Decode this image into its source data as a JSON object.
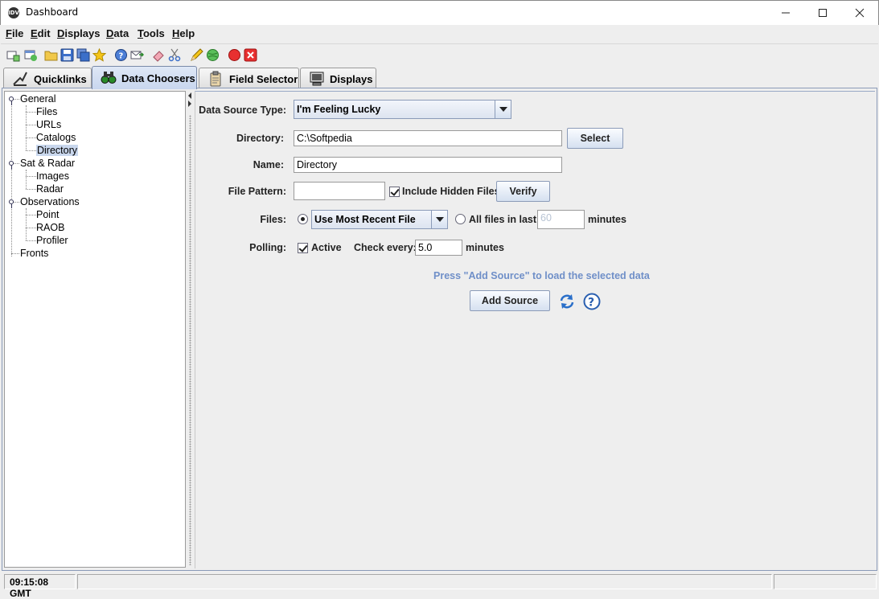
{
  "window": {
    "title": "Dashboard",
    "app_icon": "idv-logo-icon"
  },
  "menu": [
    {
      "label": "File",
      "mnemonic": "F",
      "rest": "ile"
    },
    {
      "label": "Edit",
      "mnemonic": "E",
      "rest": "dit"
    },
    {
      "label": "Displays",
      "mnemonic": "D",
      "rest": "isplays"
    },
    {
      "label": "Data",
      "mnemonic": "D",
      "rest": "ata"
    },
    {
      "label": "Tools",
      "mnemonic": "T",
      "rest": "ools"
    },
    {
      "label": "Help",
      "mnemonic": "H",
      "rest": "elp"
    }
  ],
  "toolbar_icons": [
    "new-window-icon",
    "open-folder-icon",
    "save-icon",
    "save-as-icon",
    "favorite-star-icon",
    "help-icon",
    "export-icon",
    "eraser-icon",
    "cut-icon",
    "pencil-icon",
    "globe-icon",
    "stop-icon",
    "close-icon"
  ],
  "tabs": [
    {
      "label": "Quicklinks",
      "icon": "quicklinks-icon",
      "active": false
    },
    {
      "label": "Data Choosers",
      "icon": "binoculars-icon",
      "active": true
    },
    {
      "label": "Field Selector",
      "icon": "clipboard-icon",
      "active": false
    },
    {
      "label": "Displays",
      "icon": "monitor-icon",
      "active": false
    }
  ],
  "tree": {
    "groups": [
      {
        "label": "General",
        "children": [
          "Files",
          "URLs",
          "Catalogs",
          "Directory"
        ]
      },
      {
        "label": "Sat & Radar",
        "children": [
          "Images",
          "Radar"
        ]
      },
      {
        "label": "Observations",
        "children": [
          "Point",
          "RAOB",
          "Profiler"
        ]
      },
      {
        "label": "Fronts",
        "children": []
      }
    ],
    "selected": "Directory"
  },
  "form": {
    "data_source_type_label": "Data Source Type:",
    "data_source_type_value": "I'm Feeling Lucky",
    "directory_label": "Directory:",
    "directory_value": "C:\\Softpedia",
    "select_button": "Select",
    "name_label": "Name:",
    "name_value": "Directory",
    "file_pattern_label": "File Pattern:",
    "file_pattern_value": "",
    "include_hidden_label": "Include Hidden Files",
    "include_hidden_checked": true,
    "verify_button": "Verify",
    "files_label": "Files:",
    "files_mode_value": "Use Most Recent File",
    "use_most_recent_selected": true,
    "all_files_label": "All files in last:",
    "all_files_value": "60",
    "minutes_label": "minutes",
    "polling_label": "Polling:",
    "polling_active_label": "Active",
    "polling_active_checked": true,
    "check_every_label": "Check every:",
    "check_every_value": "5.0",
    "check_every_unit": "minutes",
    "hint": "Press \"Add Source\" to load the selected data",
    "add_source_button": "Add Source"
  },
  "status": {
    "time": "09:15:08 GMT"
  }
}
